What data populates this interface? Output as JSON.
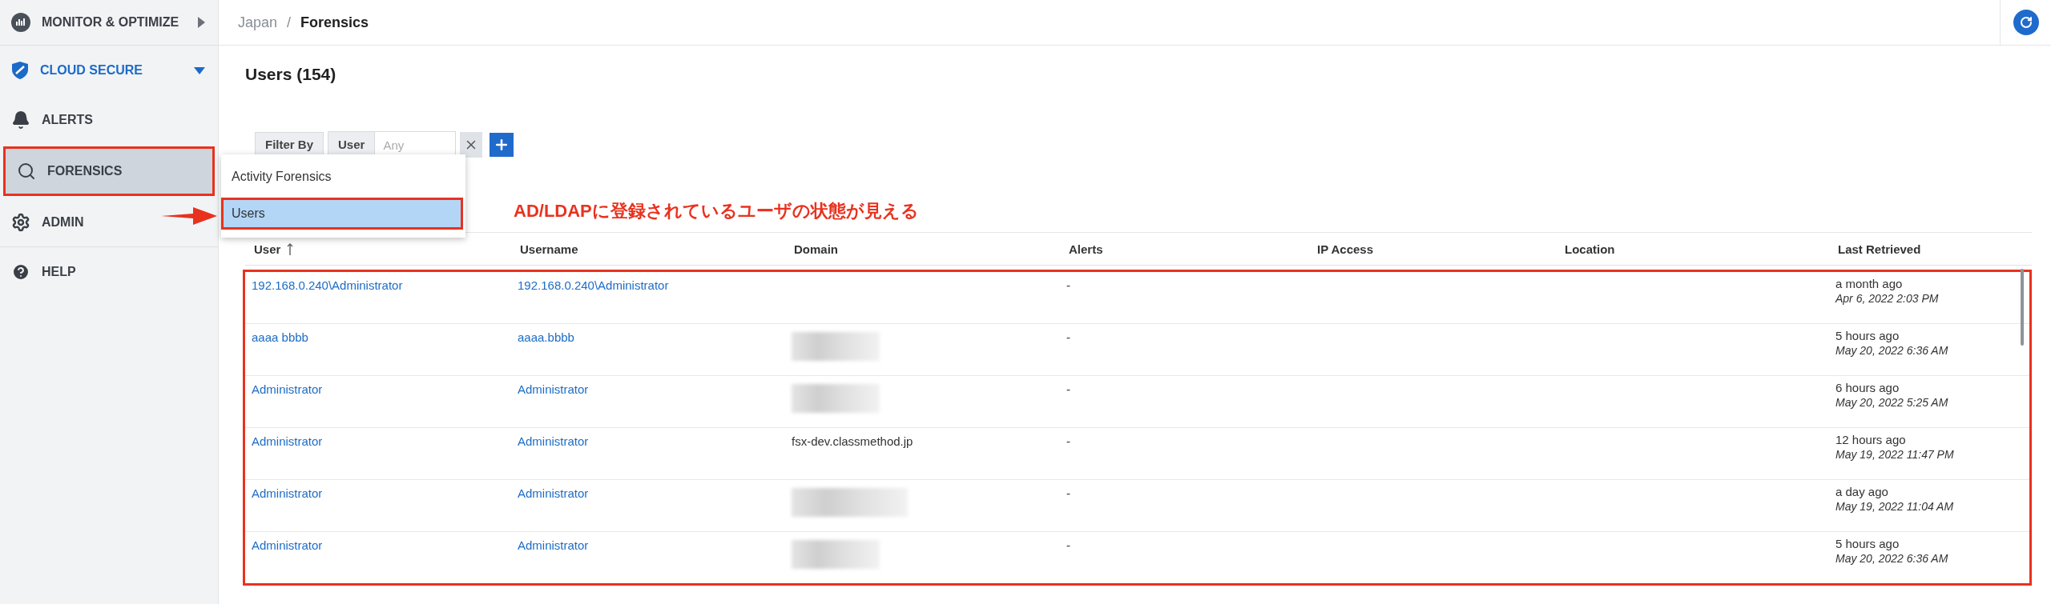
{
  "sidebar": {
    "items": [
      {
        "label": "MONITOR & OPTIMIZE",
        "kind": "group",
        "expanded": false,
        "selected": false,
        "annotated": false
      },
      {
        "label": "CLOUD SECURE",
        "kind": "group",
        "expanded": true,
        "selected": false,
        "annotated": false
      },
      {
        "label": "ALERTS",
        "kind": "link",
        "selected": false,
        "annotated": false
      },
      {
        "label": "FORENSICS",
        "kind": "link",
        "selected": true,
        "annotated": true
      },
      {
        "label": "ADMIN",
        "kind": "link",
        "selected": false,
        "annotated": false
      },
      {
        "label": "HELP",
        "kind": "link",
        "selected": false,
        "annotated": false
      }
    ]
  },
  "breadcrumb": {
    "items": [
      "Japan",
      "Forensics"
    ],
    "separator": "/"
  },
  "title": "Users (154)",
  "filter": {
    "label": "Filter By",
    "field": "User",
    "value": "Any"
  },
  "menu": {
    "items": [
      {
        "label": "Activity Forensics",
        "selected": false,
        "annotated": false
      },
      {
        "label": "Users",
        "selected": true,
        "annotated": true
      }
    ]
  },
  "annotation": {
    "text": "AD/LDAPに登録されているユーザの状態が見える"
  },
  "table": {
    "annotated": true,
    "columns": [
      {
        "label": "User",
        "sorted": true
      },
      {
        "label": "Username",
        "sorted": false
      },
      {
        "label": "Domain",
        "sorted": false
      },
      {
        "label": "Alerts",
        "sorted": false
      },
      {
        "label": "IP Access",
        "sorted": false
      },
      {
        "label": "Location",
        "sorted": false
      },
      {
        "label": "Last Retrieved",
        "sorted": false
      }
    ],
    "rows": [
      {
        "user": "192.168.0.240\\Administrator",
        "username": "192.168.0.240\\Administrator",
        "domain": {
          "kind": "blank"
        },
        "alerts": "-",
        "relative": "a month ago",
        "timestamp": "Apr 6, 2022 2:03 PM"
      },
      {
        "user": "aaaa bbbb",
        "username": "aaaa.bbbb",
        "domain": {
          "kind": "redacted"
        },
        "alerts": "-",
        "relative": "5 hours ago",
        "timestamp": "May 20, 2022 6:36 AM"
      },
      {
        "user": "Administrator",
        "username": "Administrator",
        "domain": {
          "kind": "redacted"
        },
        "alerts": "-",
        "relative": "6 hours ago",
        "timestamp": "May 20, 2022 5:25 AM"
      },
      {
        "user": "Administrator",
        "username": "Administrator",
        "domain": {
          "kind": "text",
          "text": "fsx-dev.classmethod.jp"
        },
        "alerts": "-",
        "relative": "12 hours ago",
        "timestamp": "May 19, 2022 11:47 PM"
      },
      {
        "user": "Administrator",
        "username": "Administrator",
        "domain": {
          "kind": "redacted"
        },
        "alerts": "-",
        "relative": "a day ago",
        "timestamp": "May 19, 2022 11:04 AM"
      },
      {
        "user": "Administrator",
        "username": "Administrator",
        "domain": {
          "kind": "redacted"
        },
        "alerts": "-",
        "relative": "5 hours ago",
        "timestamp": "May 20, 2022 6:36 AM"
      }
    ]
  }
}
